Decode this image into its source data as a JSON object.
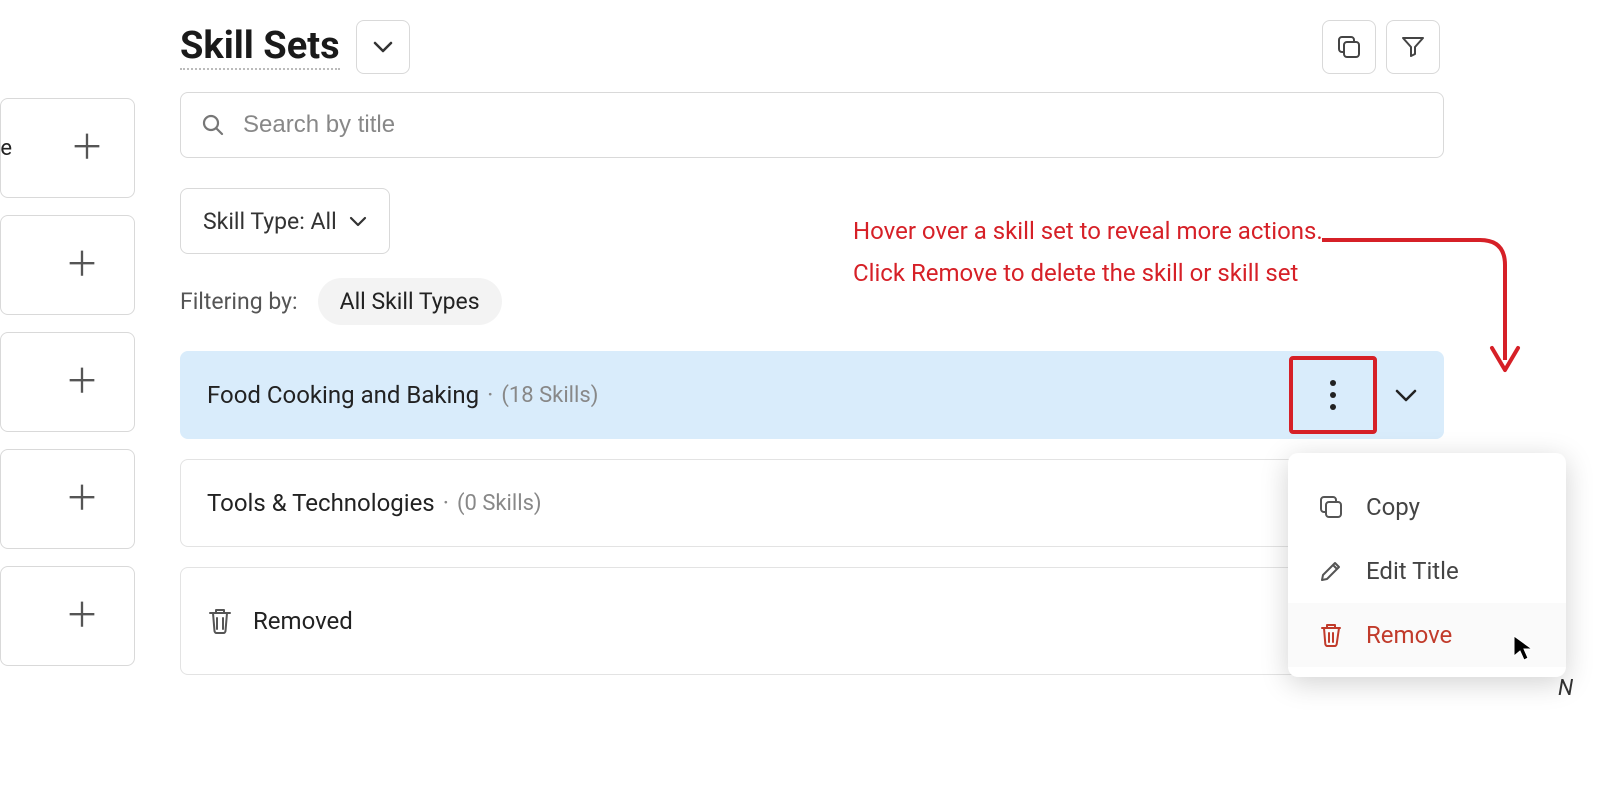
{
  "sidebar": {
    "first_label": "se"
  },
  "header": {
    "title": "Skill Sets"
  },
  "search": {
    "placeholder": "Search by title"
  },
  "filter": {
    "pill": "Skill Type: All",
    "filtering_by_label": "Filtering by:",
    "chip": "All Skill Types"
  },
  "rows": [
    {
      "title": "Food Cooking and Baking",
      "count_text": "(18 Skills)"
    },
    {
      "title": "Tools & Technologies",
      "count_text": "(0 Skills)"
    }
  ],
  "removed_row": {
    "label": "Removed"
  },
  "annotation": {
    "line1": "Hover over a skill set to reveal more actions.",
    "line2": "Click Remove to delete the skill or skill set"
  },
  "menu": {
    "copy": "Copy",
    "edit": "Edit Title",
    "remove": "Remove"
  },
  "partial": {
    "n": "N"
  }
}
